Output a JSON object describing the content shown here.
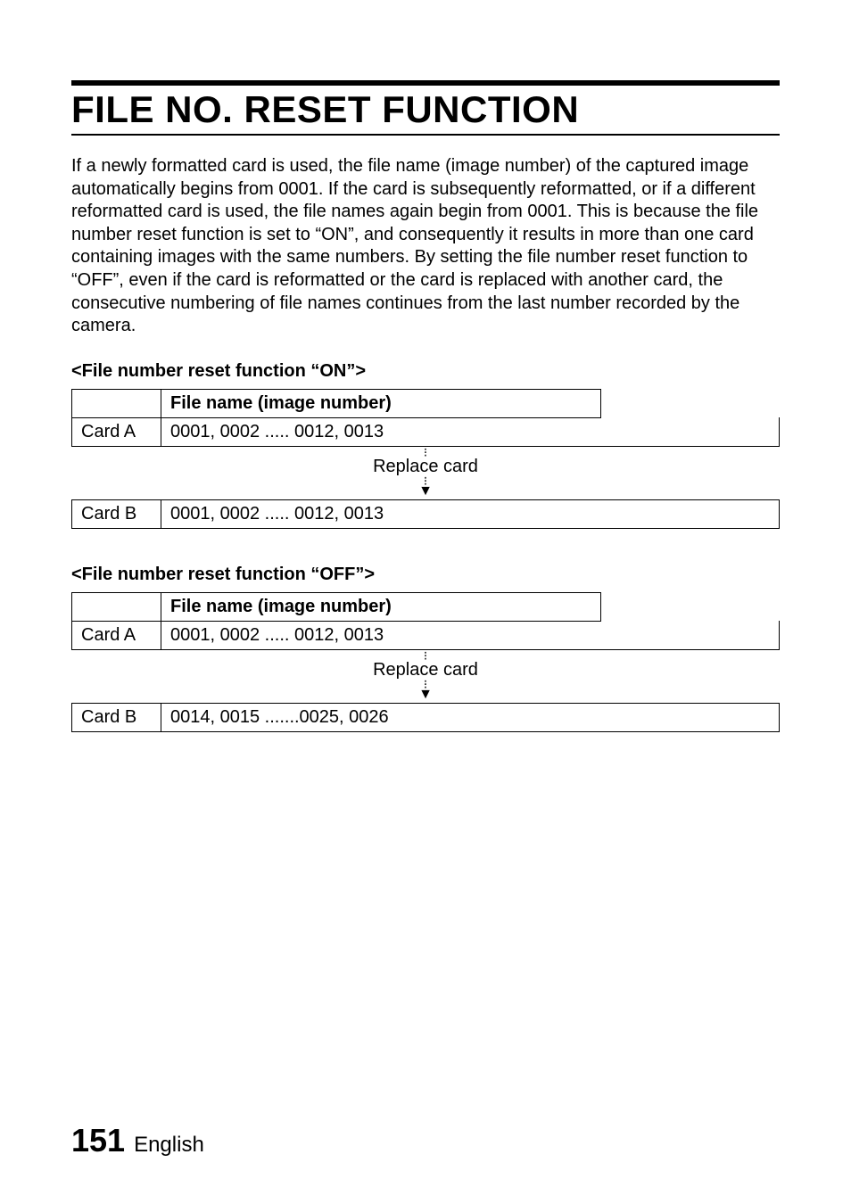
{
  "title": "FILE NO. RESET FUNCTION",
  "intro": "If a newly formatted card is used, the file name (image number) of the captured image automatically begins from 0001. If the card is subsequently reformatted, or if a different reformatted card is used, the file names again begin from 0001. This is because the file number reset function is set to “ON”, and consequently it results in more than one card containing images with the same numbers. By setting the file number reset function to “OFF”, even if the card is reformatted or the card is replaced with another card, the consecutive numbering of file names continues from the last number recorded by the camera.",
  "sections": {
    "on": {
      "label": "<File number reset function “ON”>",
      "header": "File name (image number)",
      "rowA": {
        "card": "Card A",
        "values": "0001, 0002 ..... 0012, 0013"
      },
      "replace": "Replace card",
      "rowB": {
        "card": "Card B",
        "values": "0001, 0002 ..... 0012, 0013"
      }
    },
    "off": {
      "label": "<File number reset function “OFF”>",
      "header": "File name (image number)",
      "rowA": {
        "card": "Card A",
        "values": "0001, 0002 ..... 0012, 0013"
      },
      "replace": "Replace card",
      "rowB": {
        "card": "Card B",
        "values": "0014, 0015 .......0025, 0026"
      }
    }
  },
  "footer": {
    "page": "151",
    "lang": "English"
  }
}
